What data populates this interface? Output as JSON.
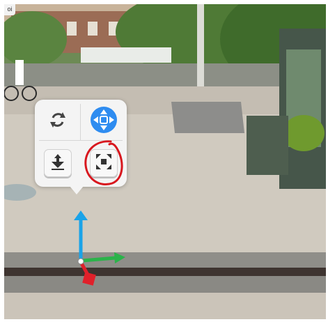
{
  "viewport": {
    "corner_tag": "oi",
    "background_scene": "outdoor-plaza-camera-feed"
  },
  "context_menu": {
    "tools": [
      {
        "name": "rotate",
        "icon": "rotate-arrows-icon",
        "selected": false
      },
      {
        "name": "move",
        "icon": "move-arrows-icon",
        "selected": true
      },
      {
        "name": "lower",
        "icon": "arrow-down-to-surface-icon",
        "selected": false
      },
      {
        "name": "scale",
        "icon": "scale-arrows-icon",
        "selected": false
      }
    ],
    "highlighted_tool": "scale"
  },
  "annotation": {
    "shape": "hand-drawn-circle",
    "color": "#d8171e",
    "target": "scale"
  },
  "gizmo": {
    "axes": [
      {
        "axis": "y",
        "color": "#1aa3e8"
      },
      {
        "axis": "x",
        "color": "#2bb34a"
      },
      {
        "axis": "z",
        "color": "#e0202a"
      }
    ]
  },
  "colors": {
    "accent_blue": "#2e8cf0",
    "menu_bg": "#f4f4f4"
  }
}
